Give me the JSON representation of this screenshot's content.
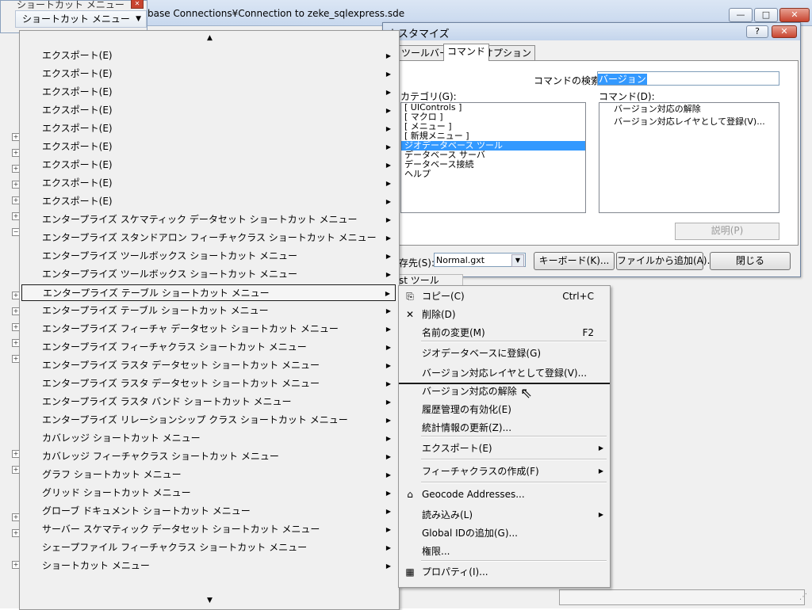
{
  "main_window": {
    "title": "base Connections¥Connection to zeke_sqlexpress.sde",
    "min_label": "—",
    "max_label": "□",
    "close_label": "✕"
  },
  "shortcut_window": {
    "title": "ショートカット メニュー",
    "button_label": "ショートカット メニュー",
    "close_label": "✕"
  },
  "customize_dialog": {
    "title": "カスタマイズ",
    "help_label": "?",
    "close_label": "✕",
    "tabs": [
      "ツールバー",
      "コマンド",
      "オプション"
    ],
    "active_tab": "コマンド",
    "search_label": "コマンドの検索:",
    "search_value": "バージョン",
    "category_label": "カテゴリ(G):",
    "command_label": "コマンド(D):",
    "categories": [
      "[ UIControls ]",
      "[ マクロ ]",
      "[ メニュー ]",
      "[ 新規メニュー ]",
      "ジオデータベース ツール",
      "データベース サーバ",
      "データベース接続",
      "ヘルプ"
    ],
    "selected_category_index": 4,
    "commands": [
      "バージョン対応の解除",
      "バージョン対応レイヤとして登録(V)..."
    ],
    "description_button": "説明(P)",
    "save_in_label": "存先(S):",
    "save_in_value": "Normal.gxt",
    "keyboard_button": "キーボード(K)...",
    "add_from_file_button": "ファイルから追加(A)...",
    "close_button": "閉じる",
    "tool_tab_fragment": "st ツール"
  },
  "main_menu": {
    "scroll_up": "▲",
    "scroll_down": "▼",
    "highlighted_index": 13,
    "items": [
      "エクスポート(E)",
      "エクスポート(E)",
      "エクスポート(E)",
      "エクスポート(E)",
      "エクスポート(E)",
      "エクスポート(E)",
      "エクスポート(E)",
      "エクスポート(E)",
      "エクスポート(E)",
      "エンタープライズ スケマティック データセット ショートカット メニュー",
      "エンタープライズ スタンドアロン フィーチャクラス ショートカット メニュー",
      "エンタープライズ ツールボックス ショートカット メニュー",
      "エンタープライズ ツールボックス ショートカット メニュー",
      "エンタープライズ テーブル ショートカット メニュー",
      "エンタープライズ テーブル ショートカット メニュー",
      "エンタープライズ フィーチャ データセット ショートカット メニュー",
      "エンタープライズ フィーチャクラス ショートカット メニュー",
      "エンタープライズ ラスタ データセット ショートカット メニュー",
      "エンタープライズ ラスタ データセット ショートカット メニュー",
      "エンタープライズ ラスタ バンド ショートカット メニュー",
      "エンタープライズ リレーションシップ クラス ショートカット メニュー",
      "カバレッジ ショートカット メニュー",
      "カバレッジ フィーチャクラス  ショートカット メニュー",
      "グラフ ショートカット メニュー",
      "グリッド ショートカット メニュー",
      "グローブ ドキュメント ショートカット メニュー",
      "サーバー スケマティック データセット ショートカット メニュー",
      "シェープファイル フィーチャクラス ショートカット メニュー",
      "ショートカット メニュー"
    ]
  },
  "context_menu": {
    "items": [
      {
        "label": "コピー(C)",
        "shortcut": "Ctrl+C",
        "icon": "copy-icon",
        "submenu": false
      },
      {
        "label": "削除(D)",
        "shortcut": "",
        "icon": "delete-icon",
        "submenu": false
      },
      {
        "label": "名前の変更(M)",
        "shortcut": "F2",
        "icon": "",
        "submenu": false
      },
      {
        "label": "ジオデータベースに登録(G)",
        "shortcut": "",
        "icon": "",
        "submenu": false
      },
      {
        "label": "バージョン対応レイヤとして登録(V)...",
        "shortcut": "",
        "icon": "",
        "submenu": false
      },
      {
        "label": "バージョン対応の解除",
        "shortcut": "",
        "icon": "",
        "submenu": false
      },
      {
        "label": "履歴管理の有効化(E)",
        "shortcut": "",
        "icon": "",
        "submenu": false
      },
      {
        "label": "統計情報の更新(Z)...",
        "shortcut": "",
        "icon": "",
        "submenu": false
      },
      {
        "label": "エクスポート(E)",
        "shortcut": "",
        "icon": "",
        "submenu": true
      },
      {
        "label": "フィーチャクラスの作成(F)",
        "shortcut": "",
        "icon": "",
        "submenu": true
      },
      {
        "label": "Geocode Addresses...",
        "shortcut": "",
        "icon": "geocode-icon",
        "submenu": false
      },
      {
        "label": "読み込み(L)",
        "shortcut": "",
        "icon": "",
        "submenu": true
      },
      {
        "label": "Global IDの追加(G)...",
        "shortcut": "",
        "icon": "",
        "submenu": false
      },
      {
        "label": "権限...",
        "shortcut": "",
        "icon": "",
        "submenu": false
      },
      {
        "label": "プロパティ(I)...",
        "shortcut": "",
        "icon": "properties-icon",
        "submenu": false
      }
    ]
  },
  "tree_expanders": [
    "+",
    "+",
    "+",
    "+",
    "+",
    "+",
    "−",
    "+",
    "+",
    "+",
    "+",
    "+",
    "+",
    "+",
    "+",
    "+",
    "+"
  ]
}
